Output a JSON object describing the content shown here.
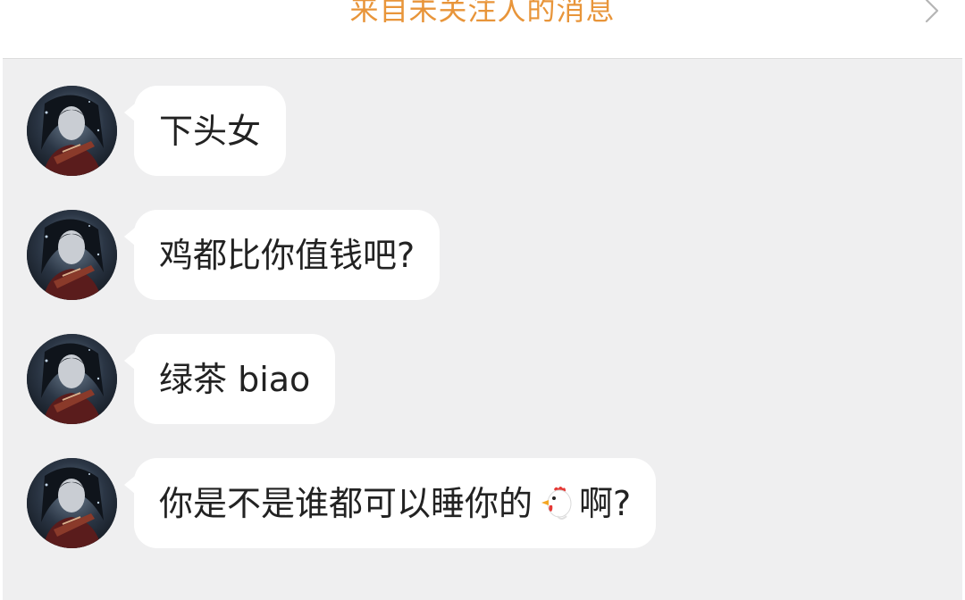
{
  "header": {
    "title": "来自未关注人的消息",
    "chevron_icon": "chevron-right-icon",
    "title_color": "#e8953a"
  },
  "messages": [
    {
      "text": "下头女"
    },
    {
      "text": "鸡都比你值钱吧?"
    },
    {
      "text": "绿茶 biao"
    },
    {
      "text_before": "你是不是谁都可以睡你的",
      "icon": "rooster-emoji",
      "text_after": "啊?"
    }
  ],
  "colors": {
    "background": "#efeff0",
    "bubble": "#ffffff",
    "text": "#222222"
  }
}
